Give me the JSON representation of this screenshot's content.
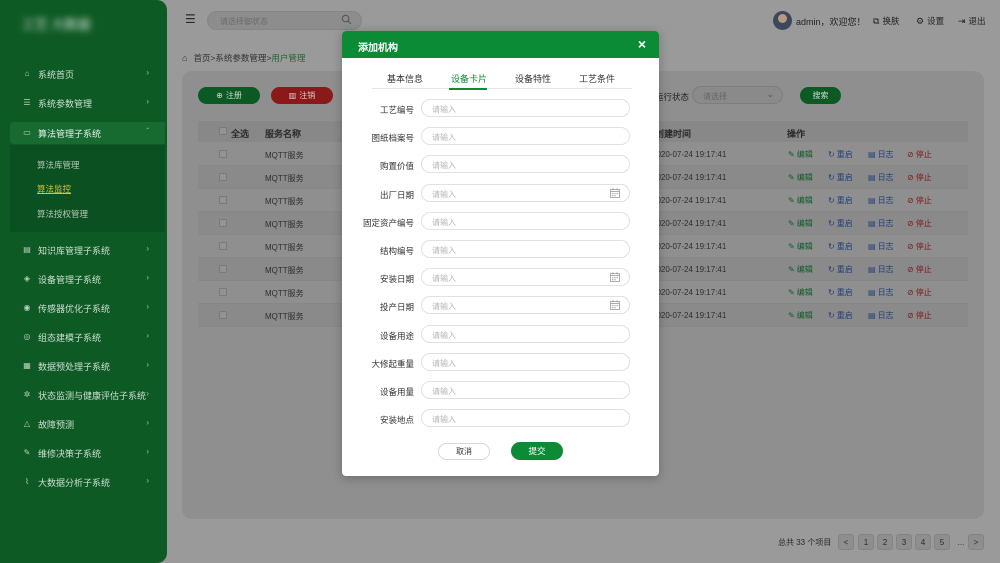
{
  "colors": {
    "brand": "#0c8b37",
    "sidebar": "#0e5a25",
    "danger": "#8a1a1a",
    "link_blue": "#1f3e7a"
  },
  "sidebar": {
    "logo": "工艺 大数据",
    "items": [
      {
        "label": "系统首页",
        "icon": "home-icon"
      },
      {
        "label": "系统参数管理",
        "icon": "sliders-icon"
      },
      {
        "label": "算法管理子系统",
        "icon": "monitor-icon"
      },
      {
        "label": "知识库管理子系统",
        "icon": "book-icon"
      },
      {
        "label": "设备管理子系统",
        "icon": "layers-icon"
      },
      {
        "label": "传感器优化子系统",
        "icon": "signal-icon"
      },
      {
        "label": "组态建模子系统",
        "icon": "target-icon"
      },
      {
        "label": "数据预处理子系统",
        "icon": "grid-icon"
      },
      {
        "label": "状态监测与健康评估子系统",
        "icon": "gear-icon"
      },
      {
        "label": "故障预测",
        "icon": "alert-icon"
      },
      {
        "label": "维修决策子系统",
        "icon": "wrench-icon"
      },
      {
        "label": "大数据分析子系统",
        "icon": "chart-icon"
      }
    ],
    "subitems": [
      {
        "label": "算法库管理"
      },
      {
        "label": "算法监控"
      },
      {
        "label": "算法授权管理"
      }
    ]
  },
  "header": {
    "search_placeholder": "请选择御状态",
    "user": "admin，欢迎您！",
    "actions": [
      {
        "label": "换肤",
        "icon": "skin-icon"
      },
      {
        "label": "设置",
        "icon": "gear-icon"
      },
      {
        "label": "退出",
        "icon": "logout-icon"
      }
    ]
  },
  "breadcrumb": {
    "home": "首页",
    "sep": ">",
    "level1": "系统参数管理",
    "current": "用户管理"
  },
  "toolbar": {
    "register": "注册",
    "cancel": "注销",
    "filter_label": "运行状态",
    "filter_placeholder": "请选择",
    "search": "搜索"
  },
  "table": {
    "headers": {
      "all": "全选",
      "name": "服务名称",
      "created": "创建时间",
      "ops": "操作"
    },
    "rows": [
      {
        "name": "MQTT服务",
        "time": "2020-07-24 19:17:41"
      },
      {
        "name": "MQTT服务",
        "time": "2020-07-24 19:17:41"
      },
      {
        "name": "MQTT服务",
        "time": "2020-07-24 19:17:41"
      },
      {
        "name": "MQTT服务",
        "time": "2020-07-24 19:17:41"
      },
      {
        "name": "MQTT服务",
        "time": "2020-07-24 19:17:41"
      },
      {
        "name": "MQTT服务",
        "time": "2020-07-24 19:17:41"
      },
      {
        "name": "MQTT服务",
        "time": "2020-07-24 19:17:41"
      },
      {
        "name": "MQTT服务",
        "time": "2020-07-24 19:17:41"
      }
    ],
    "ops": {
      "edit": "编辑",
      "restart": "重启",
      "log": "日志",
      "stop": "停止"
    }
  },
  "pagination": {
    "total": "总共 33 个项目",
    "prev": "<",
    "pages": [
      "1",
      "2",
      "3",
      "4",
      "5"
    ],
    "ellipsis": "...",
    "next": ">"
  },
  "modal": {
    "title": "添加机构",
    "close": "×",
    "tabs": [
      "基本信息",
      "设备卡片",
      "设备特性",
      "工艺条件"
    ],
    "active_tab": 1,
    "fields": [
      {
        "label": "工艺编号",
        "placeholder": "请输入",
        "date": false
      },
      {
        "label": "图纸档案号",
        "placeholder": "请输入",
        "date": false
      },
      {
        "label": "购置价值",
        "placeholder": "请输入",
        "date": false
      },
      {
        "label": "出厂日期",
        "placeholder": "请输入",
        "date": true
      },
      {
        "label": "固定资产编号",
        "placeholder": "请输入",
        "date": false
      },
      {
        "label": "结构编号",
        "placeholder": "请输入",
        "date": false
      },
      {
        "label": "安装日期",
        "placeholder": "请输入",
        "date": true
      },
      {
        "label": "投产日期",
        "placeholder": "请输入",
        "date": true
      },
      {
        "label": "设备用途",
        "placeholder": "请输入",
        "date": false
      },
      {
        "label": "大修起重量",
        "placeholder": "请输入",
        "date": false
      },
      {
        "label": "设备用量",
        "placeholder": "请输入",
        "date": false
      },
      {
        "label": "安装地点",
        "placeholder": "请输入",
        "date": false
      }
    ],
    "cancel": "取消",
    "submit": "提交"
  }
}
